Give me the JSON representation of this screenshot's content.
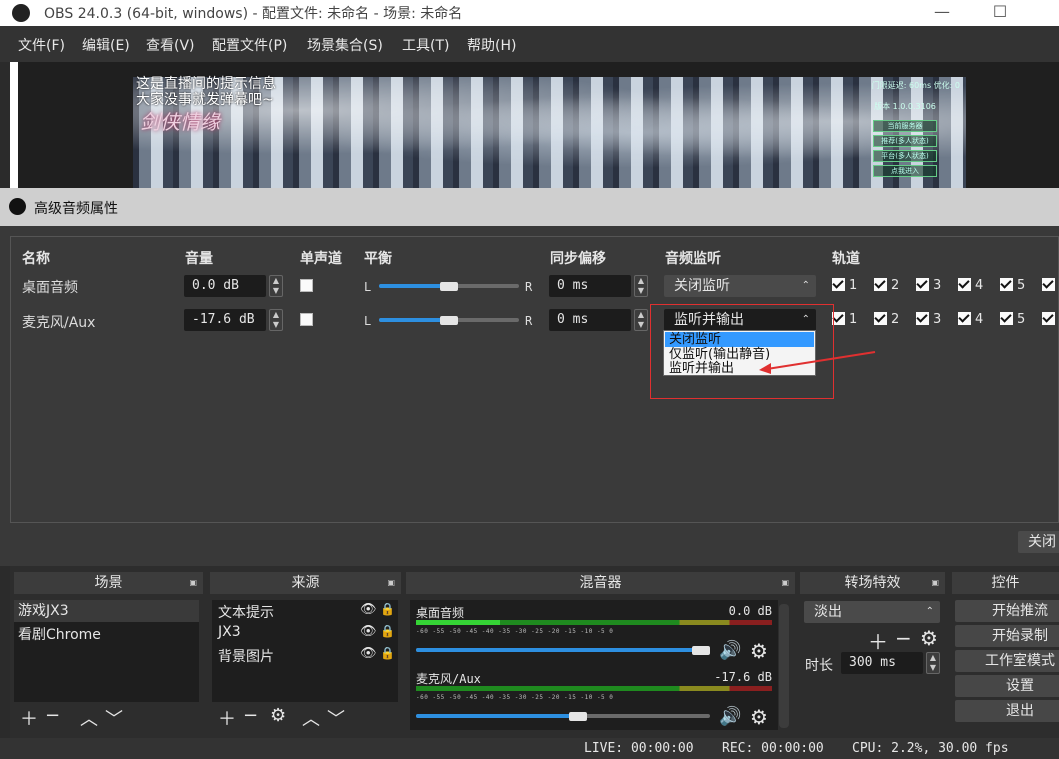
{
  "window": {
    "title": "OBS 24.0.3 (64-bit, windows) - 配置文件: 未命名 - 场景: 未命名",
    "minimize": "—",
    "maximize": "☐"
  },
  "menu": [
    "文件(F)",
    "编辑(E)",
    "查看(V)",
    "配置文件(P)",
    "场景集合(S)",
    "工具(T)",
    "帮助(H)"
  ],
  "preview": {
    "overlay_line1": "这是直播间的提示信息",
    "overlay_line2": "大家没事就发弹幕吧~",
    "game_logo": "剑侠情缘",
    "hud_lines": [
      "门限延迟:   60ms   优化: 0",
      "版本 1.0.0.3106"
    ],
    "hud_buttons": [
      "当前服务器",
      "推荐(多人状态)",
      "平台(多人状态)",
      "点我进入"
    ]
  },
  "dialog": {
    "title": "高级音频属性",
    "columns": {
      "name": "名称",
      "volume": "音量",
      "mono": "单声道",
      "balance": "平衡",
      "sync": "同步偏移",
      "monitor": "音频监听",
      "tracks": "轨道"
    },
    "rows": [
      {
        "name": "桌面音频",
        "volume": "0.0 dB",
        "balance_fraction": 0.5,
        "sync": "0 ms",
        "monitor": "关闭监听",
        "tracks": [
          "1",
          "2",
          "3",
          "4",
          "5"
        ]
      },
      {
        "name": "麦克风/Aux",
        "volume": "-17.6 dB",
        "balance_fraction": 0.5,
        "sync": "0 ms",
        "monitor": "监听并输出",
        "tracks": [
          "1",
          "2",
          "3",
          "4",
          "5"
        ]
      }
    ],
    "balance_left": "L",
    "balance_right": "R",
    "dropdown_options": [
      "关闭监听",
      "仅监听(输出静音)",
      "监听并输出"
    ],
    "dropdown_highlight_index": 0,
    "close": "关闭"
  },
  "docks": {
    "scenes": {
      "title": "场景",
      "items": [
        "游戏JX3",
        "看剧Chrome"
      ]
    },
    "sources": {
      "title": "来源",
      "items": [
        "文本提示",
        "JX3",
        "背景图片"
      ]
    },
    "mixer": {
      "title": "混音器",
      "channels": [
        {
          "name": "桌面音频",
          "db": "0.0 dB",
          "volume_fraction": 1.0
        },
        {
          "name": "麦克风/Aux",
          "db": "-17.6 dB",
          "volume_fraction": 0.55
        }
      ],
      "scale": "-60  -55  -50  -45  -40  -35  -30  -25  -20  -15  -10   -5    0"
    },
    "transitions": {
      "title": "转场特效",
      "selected": "淡出",
      "duration_label": "时长",
      "duration": "300 ms"
    },
    "controls": {
      "title": "控件",
      "buttons": [
        "开始推流",
        "开始录制",
        "工作室模式",
        "设置",
        "退出"
      ]
    }
  },
  "status": {
    "live": "LIVE: 00:00:00",
    "rec": "REC: 00:00:00",
    "cpu": "CPU: 2.2%, 30.00 fps"
  },
  "colors": {
    "accent": "#2d8fe0",
    "highlight": "#3399ff",
    "annotation_red": "#e03030"
  }
}
